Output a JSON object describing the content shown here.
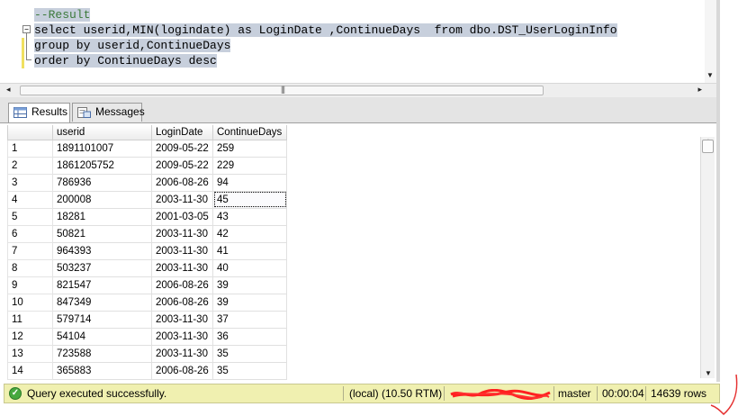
{
  "editor": {
    "lines": [
      "--Result",
      "select userid,MIN(logindate) as LoginDate ,ContinueDays  from dbo.DST_UserLoginInfo",
      "group by userid,ContinueDays",
      "order by ContinueDays desc"
    ]
  },
  "tabs": [
    {
      "label": "Results",
      "icon": "results-grid-icon"
    },
    {
      "label": "Messages",
      "icon": "messages-icon"
    }
  ],
  "grid": {
    "columns": [
      "userid",
      "LoginDate",
      "ContinueDays"
    ],
    "rows": [
      [
        "1",
        "1891101007",
        "2009-05-22",
        "259"
      ],
      [
        "2",
        "1861205752",
        "2009-05-22",
        "229"
      ],
      [
        "3",
        "786936",
        "2006-08-26",
        "94"
      ],
      [
        "4",
        "200008",
        "2003-11-30",
        "45"
      ],
      [
        "5",
        "18281",
        "2001-03-05",
        "43"
      ],
      [
        "6",
        "50821",
        "2003-11-30",
        "42"
      ],
      [
        "7",
        "964393",
        "2003-11-30",
        "41"
      ],
      [
        "8",
        "503237",
        "2003-11-30",
        "40"
      ],
      [
        "9",
        "821547",
        "2006-08-26",
        "39"
      ],
      [
        "10",
        "847349",
        "2006-08-26",
        "39"
      ],
      [
        "11",
        "579714",
        "2003-11-30",
        "37"
      ],
      [
        "12",
        "54104",
        "2003-11-30",
        "36"
      ],
      [
        "13",
        "723588",
        "2003-11-30",
        "35"
      ],
      [
        "14",
        "365883",
        "2006-08-26",
        "35"
      ]
    ],
    "selected_cell": {
      "row": 4,
      "column": "ContinueDays"
    }
  },
  "status": {
    "message": "Query executed successfully.",
    "server": "(local) (10.50 RTM)",
    "database": "master",
    "elapsed": "00:00:04",
    "rows": "14639 rows"
  },
  "colors": {
    "status_bg": "#f0f0b0",
    "selection": "#c7cfdc",
    "redaction": "#ff2020",
    "success": "#46a83e"
  }
}
